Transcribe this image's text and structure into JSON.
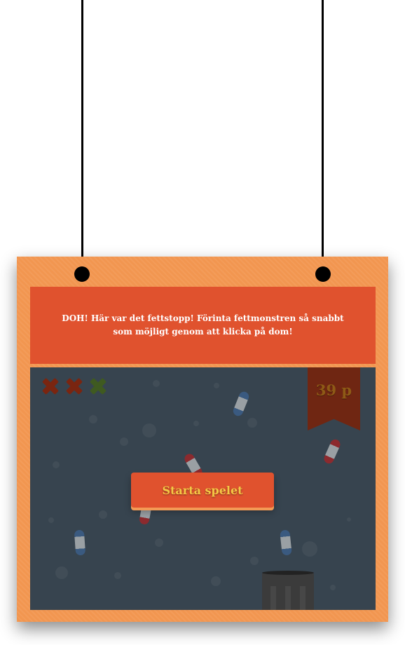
{
  "banner": {
    "text": "DOH! Här var det fettstopp! Förinta fettmonstren så snabbt som möjligt genom att klicka på dom!"
  },
  "game": {
    "score": "39 p",
    "lives": [
      {
        "state": "lost",
        "color": "#7a2510"
      },
      {
        "state": "lost",
        "color": "#7a2510"
      },
      {
        "state": "remaining",
        "color": "#3f5a20"
      }
    ],
    "start_button_label": "Starta spelet",
    "icons": [
      "x-mark-icon",
      "pill-icon",
      "trash-bin-icon"
    ]
  },
  "colors": {
    "frame": "#f29650",
    "banner": "#e0522e",
    "game_background": "#37444f",
    "ribbon": "#6f2612",
    "button": "#e0522e",
    "button_text": "#f5c845"
  }
}
